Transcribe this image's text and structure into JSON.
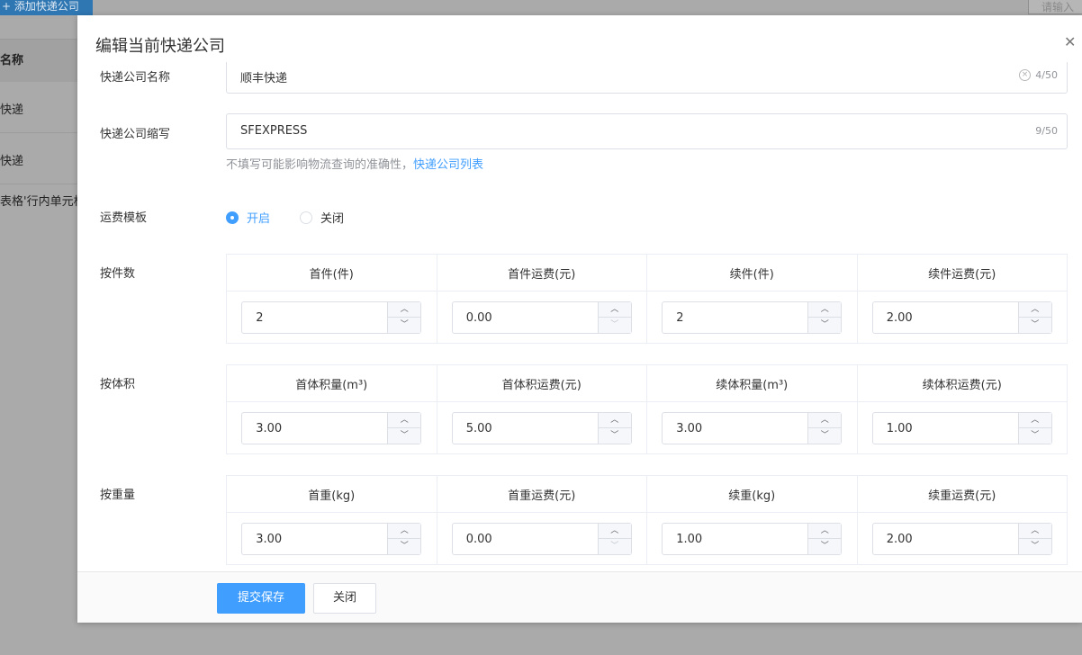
{
  "background": {
    "add_button": "+ 添加快递公司",
    "search_placeholder": "请输入",
    "table_header": "名称",
    "rows": [
      "快递",
      "快递"
    ],
    "note": "表格'行内单元格"
  },
  "modal": {
    "title": "编辑当前快递公司",
    "company_name": {
      "label": "快递公司名称",
      "value": "顺丰快递",
      "count": "4/50"
    },
    "company_code": {
      "label": "快递公司缩写",
      "value": "SFEXPRESS",
      "count": "9/50"
    },
    "hint": {
      "text": "不填写可能影响物流查询的准确性，",
      "link": "快递公司列表"
    },
    "template": {
      "label": "运费模板",
      "options": [
        "开启",
        "关闭"
      ],
      "selected": "开启"
    },
    "by_piece": {
      "label": "按件数",
      "headers": [
        "首件(件)",
        "首件运费(元)",
        "续件(件)",
        "续件运费(元)"
      ],
      "values": [
        "2",
        "0.00",
        "2",
        "2.00"
      ]
    },
    "by_volume": {
      "label": "按体积",
      "headers": [
        "首体积量(m³)",
        "首体积运费(元)",
        "续体积量(m³)",
        "续体积运费(元)"
      ],
      "values": [
        "3.00",
        "5.00",
        "3.00",
        "1.00"
      ]
    },
    "by_weight": {
      "label": "按重量",
      "headers": [
        "首重(kg)",
        "首重运费(元)",
        "续重(kg)",
        "续重运费(元)"
      ],
      "values": [
        "3.00",
        "0.00",
        "1.00",
        "2.00"
      ]
    },
    "footer": {
      "submit": "提交保存",
      "close": "关闭"
    }
  },
  "icons": {
    "close": "close-icon",
    "clear": "clear-circle-icon",
    "up": "chevron-up-icon",
    "down": "chevron-down-icon"
  },
  "colors": {
    "primary": "#409eff",
    "border": "#dcdfe6",
    "muted": "#909399"
  }
}
